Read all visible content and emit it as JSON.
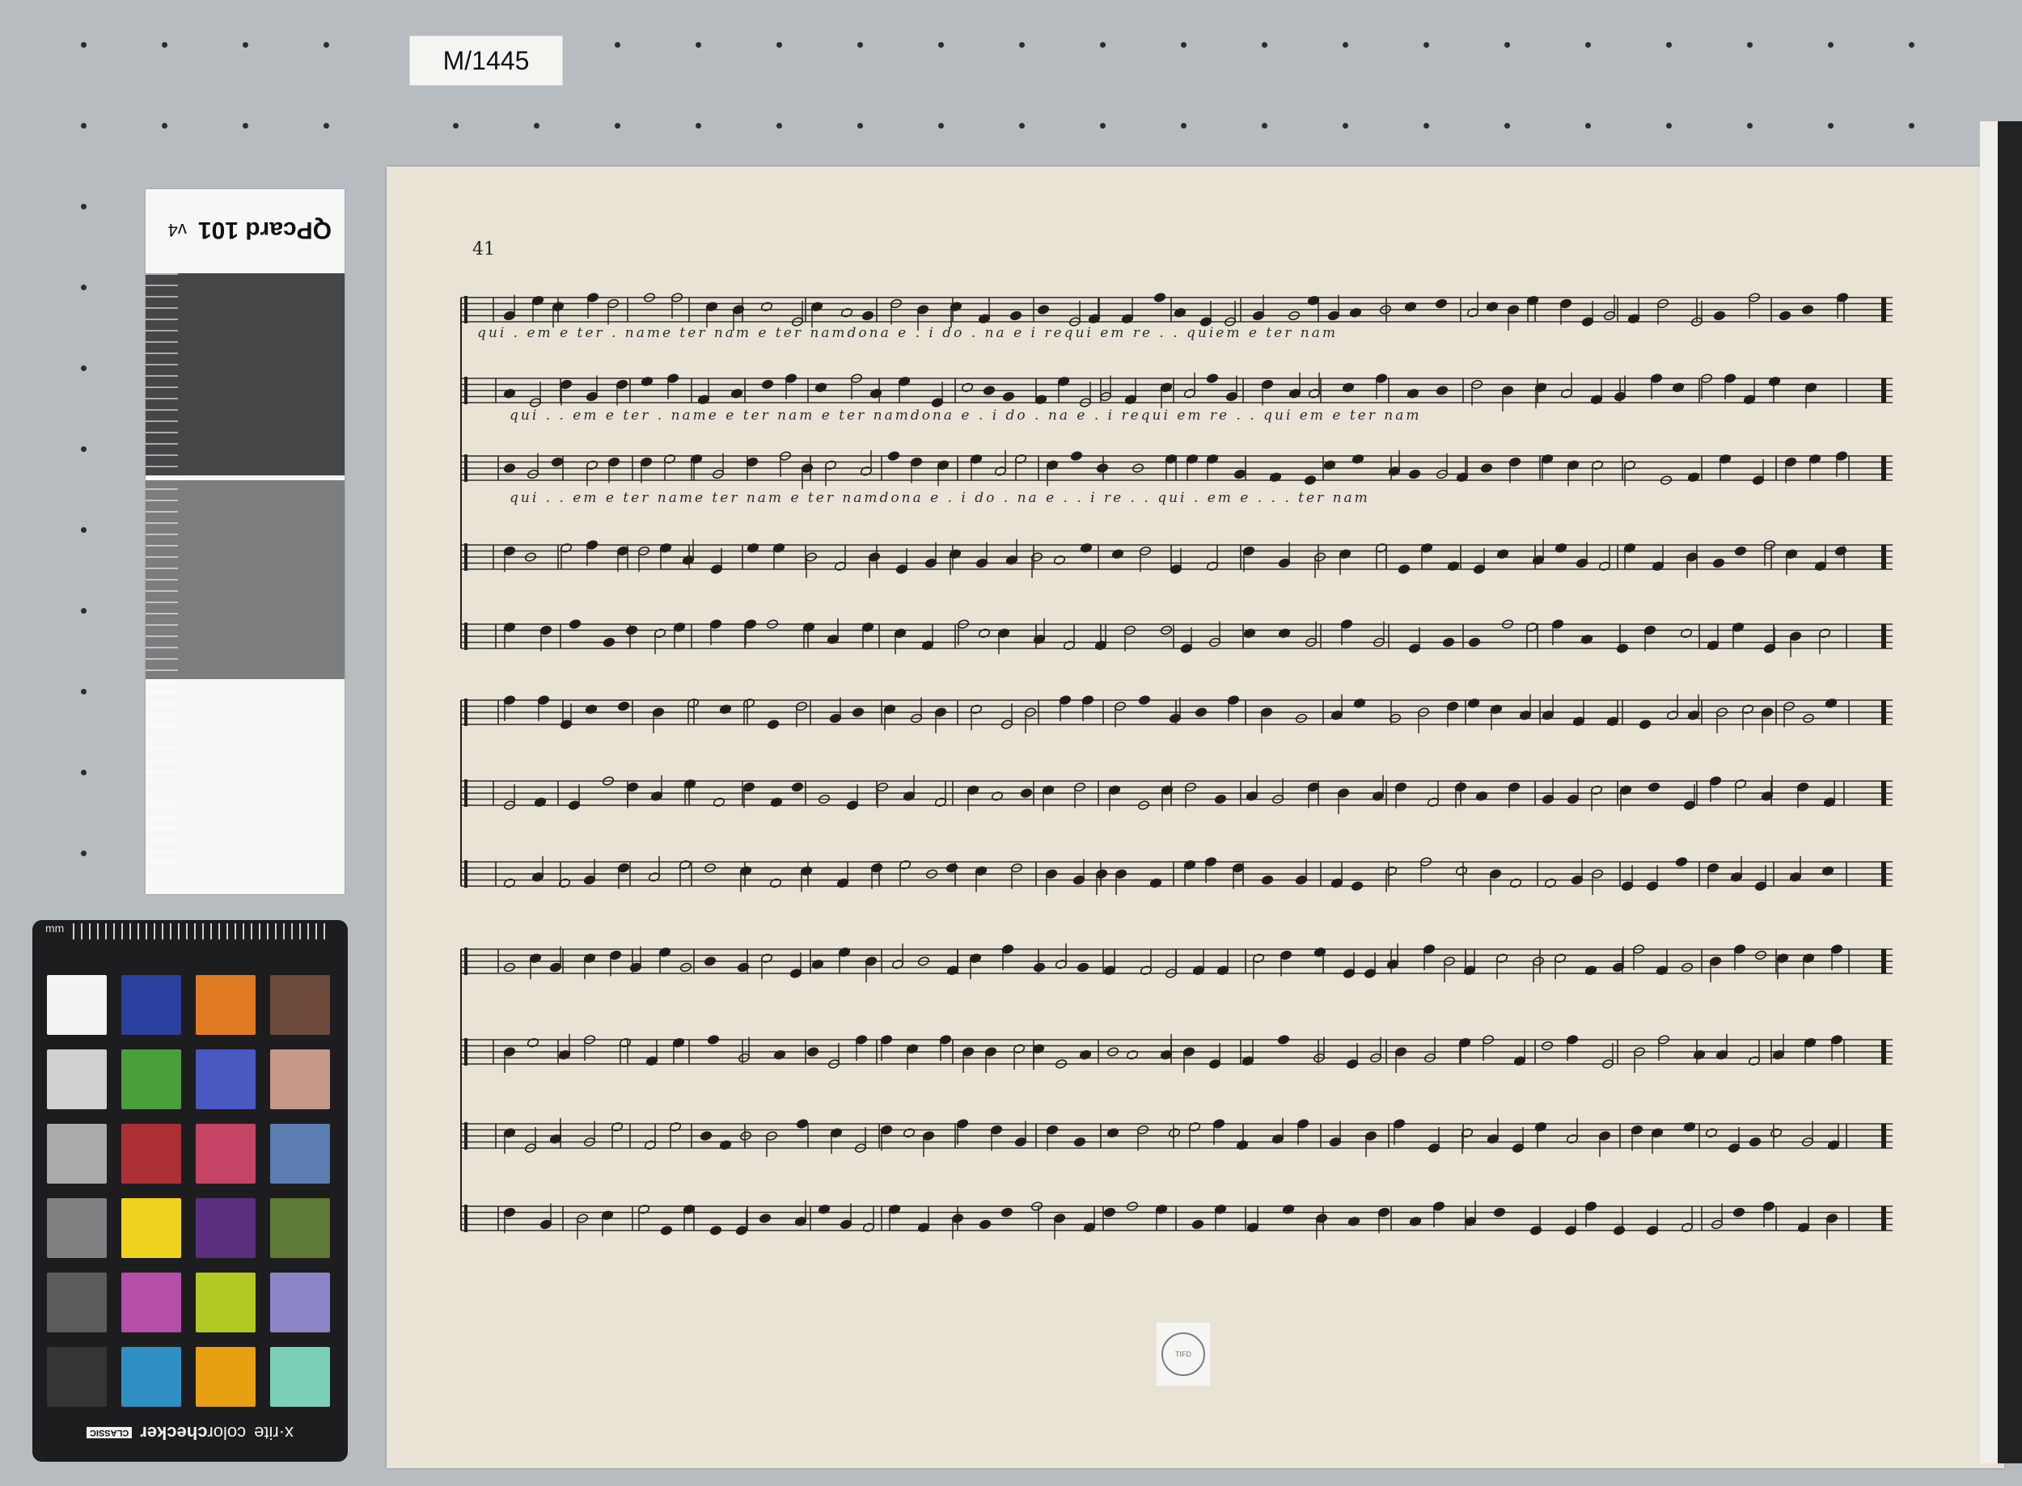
{
  "call_number": "M/1445",
  "qpcard": {
    "label": "QPcard 101",
    "version": "v4"
  },
  "colorchecker": {
    "brand": "x·rite",
    "product_prefix": "color",
    "product_bold": "checker",
    "edition": "CLASSIC",
    "unit": "mm",
    "patches": [
      "#f3f3f1",
      "#2b3f9e",
      "#e07a22",
      "#6d4a3b",
      "#cfd0cf",
      "#4a9e3c",
      "#4a58c2",
      "#c59888",
      "#a9abab",
      "#ad2f36",
      "#c54466",
      "#5b7daf",
      "#7f8081",
      "#f1d21f",
      "#5b2f7e",
      "#5f7a34",
      "#5a5b5c",
      "#b44ea7",
      "#b4c824",
      "#8a86c6",
      "#343535",
      "#2f8fc2",
      "#e7a012",
      "#7ccfb7"
    ]
  },
  "score": {
    "page_number": "41",
    "lyrics": [
      "qui . em e ter . name ter       nam   e  ter        namdona e . i   do . na  e  i  requi em    re . . quiem  e  ter                           nam",
      "qui . . em  e  ter . name e ter         nam     e  ter          namdona e . i   do . na  e . i  requi em   re . . qui em e  ter                        nam",
      "qui . . em e  ter  name  ter         nam     e  ter        namdona e . i   do . na   e . . i    re . . qui . em    e . . .  ter                    nam"
    ]
  }
}
